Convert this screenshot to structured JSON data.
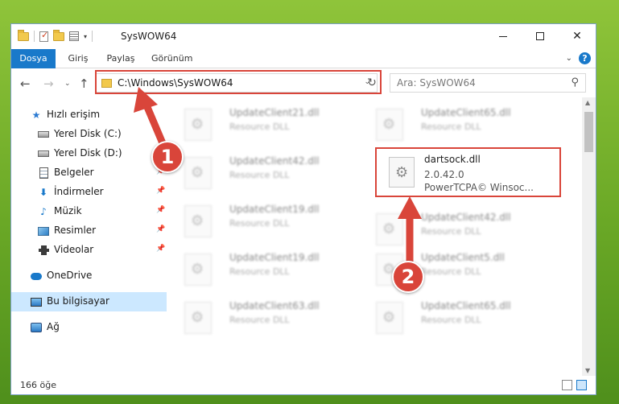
{
  "titlebar": {
    "title": "SysWOW64",
    "minimize": "",
    "maximize": "",
    "close": "✕"
  },
  "ribbon": {
    "tabs": [
      "Dosya",
      "Giriş",
      "Paylaş",
      "Görünüm"
    ],
    "help": "?"
  },
  "nav": {
    "address": "C:\\Windows\\SysWOW64",
    "search_placeholder": "Ara: SysWOW64"
  },
  "sidebar": {
    "items": [
      {
        "label": "Hızlı erişim",
        "icon": "star-icon"
      },
      {
        "label": "Yerel Disk (C:)",
        "icon": "drive-icon"
      },
      {
        "label": "Yerel Disk (D:)",
        "icon": "drive-icon"
      },
      {
        "label": "Belgeler",
        "icon": "documents-icon"
      },
      {
        "label": "İndirmeler",
        "icon": "download-icon"
      },
      {
        "label": "Müzik",
        "icon": "music-icon"
      },
      {
        "label": "Resimler",
        "icon": "pictures-icon"
      },
      {
        "label": "Videolar",
        "icon": "videos-icon"
      },
      {
        "label": "OneDrive",
        "icon": "cloud-icon"
      },
      {
        "label": "Bu bilgisayar",
        "icon": "computer-icon"
      },
      {
        "label": "Ağ",
        "icon": "network-icon"
      }
    ],
    "pin": "📌"
  },
  "files": {
    "left": [
      {
        "name": "UpdateClient21.dll",
        "desc": "Resource DLL"
      },
      {
        "name": "UpdateClient42.dll",
        "desc": "Resource DLL"
      },
      {
        "name": "UpdateClient19.dll",
        "desc": "Resource DLL"
      },
      {
        "name": "UpdateClient19.dll",
        "desc": "Resource DLL"
      },
      {
        "name": "UpdateClient63.dll",
        "desc": "Resource DLL"
      }
    ],
    "right": [
      {
        "name": "UpdateClient65.dll",
        "desc": "Resource DLL"
      },
      {
        "name": "UpdateClient42.dll",
        "desc": "Resource DLL"
      },
      {
        "name": "UpdateClient5.dll",
        "desc": "Resource DLL"
      },
      {
        "name": "UpdateClient65.dll",
        "desc": "Resource DLL"
      }
    ],
    "highlighted": {
      "name": "dartsock.dll",
      "version": "2.0.42.0",
      "company": "PowerTCPA© Winsoc..."
    }
  },
  "status": {
    "count": "166 öğe"
  },
  "annotations": {
    "badge1": "1",
    "badge2": "2",
    "color": "#d9453a"
  }
}
